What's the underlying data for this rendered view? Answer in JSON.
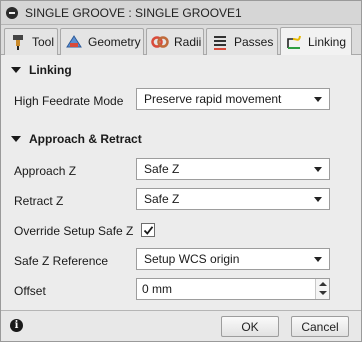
{
  "window": {
    "title": "SINGLE GROOVE : SINGLE GROOVE1"
  },
  "tabs": [
    {
      "label": "Tool",
      "icon": "tool-holder-icon",
      "active": false
    },
    {
      "label": "Geometry",
      "icon": "geometry-icon",
      "active": false
    },
    {
      "label": "Radii",
      "icon": "radii-icon",
      "active": false
    },
    {
      "label": "Passes",
      "icon": "passes-icon",
      "active": false
    },
    {
      "label": "Linking",
      "icon": "linking-icon",
      "active": true
    }
  ],
  "linking": {
    "section_title": "Linking",
    "high_feedrate_label": "High Feedrate Mode",
    "high_feedrate_value": "Preserve rapid movement"
  },
  "approach": {
    "section_title": "Approach & Retract",
    "approach_z_label": "Approach Z",
    "approach_z_value": "Safe Z",
    "retract_z_label": "Retract Z",
    "retract_z_value": "Safe Z",
    "override_label": "Override Setup Safe Z",
    "override_checked": true,
    "safe_z_ref_label": "Safe Z Reference",
    "safe_z_ref_value": "Setup WCS origin",
    "offset_label": "Offset",
    "offset_value": "0 mm"
  },
  "footer": {
    "ok_label": "OK",
    "cancel_label": "Cancel"
  },
  "colors": {
    "dialog_bg": "#ececec",
    "title_bg": "#d6d6d6",
    "field_bg": "#ffffff"
  }
}
